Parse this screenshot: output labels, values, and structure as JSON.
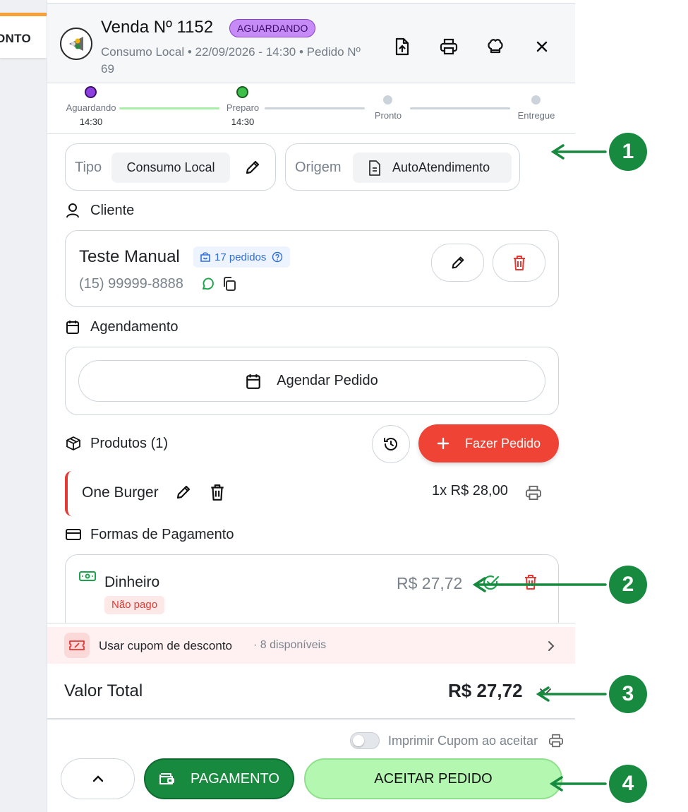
{
  "left_app": {
    "tab_label": "ONTO"
  },
  "header": {
    "title": "Venda Nº 1152",
    "status": "AGUARDANDO",
    "subtitle": "Consumo Local • 22/09/2026 - 14:30 • Pedido Nº 69",
    "icons": [
      "file-upload-icon",
      "printer-icon",
      "chef-hat-icon",
      "close-icon"
    ]
  },
  "stepper": {
    "steps": [
      {
        "label": "Aguardando",
        "time": "14:30",
        "state": "current",
        "color": "#8e3fe0"
      },
      {
        "label": "Preparo",
        "time": "14:30",
        "state": "done",
        "color": "#3cc04a"
      },
      {
        "label": "Pronto",
        "time": "",
        "state": "pending",
        "color": "#cdd3da"
      },
      {
        "label": "Entregue",
        "time": "",
        "state": "pending",
        "color": "#cdd3da"
      }
    ]
  },
  "tipo": {
    "label": "Tipo",
    "value": "Consumo Local"
  },
  "origem": {
    "label": "Origem",
    "value": "AutoAtendimento"
  },
  "cliente": {
    "section_title": "Cliente",
    "name": "Teste Manual",
    "orders_badge": "17 pedidos",
    "phone": "(15) 99999-8888"
  },
  "agendamento": {
    "section_title": "Agendamento",
    "button_label": "Agendar Pedido"
  },
  "produtos": {
    "section_title": "Produtos (1)",
    "new_order_label": "Fazer Pedido",
    "items": [
      {
        "name": "One Burger",
        "qty_price": "1x R$ 28,00"
      }
    ]
  },
  "pagamento": {
    "section_title": "Formas de Pagamento",
    "method": "Dinheiro",
    "status": "Não pago",
    "amount": "R$ 27,72"
  },
  "cupom": {
    "label": "Usar cupom de desconto",
    "available": "· 8 disponíveis"
  },
  "total": {
    "label": "Valor Total",
    "value": "R$ 27,72"
  },
  "footer": {
    "print_toggle_label": "Imprimir Cupom ao aceitar",
    "payment_label": "PAGAMENTO",
    "accept_label": "ACEITAR PEDIDO"
  },
  "annotations": [
    "1",
    "2",
    "3",
    "4"
  ],
  "colors": {
    "primary_green": "#178a3f",
    "accept_green": "#b4f7b1",
    "danger_red": "#e53935",
    "purple": "#8e3fe0",
    "link_blue": "#2f6fdc"
  }
}
